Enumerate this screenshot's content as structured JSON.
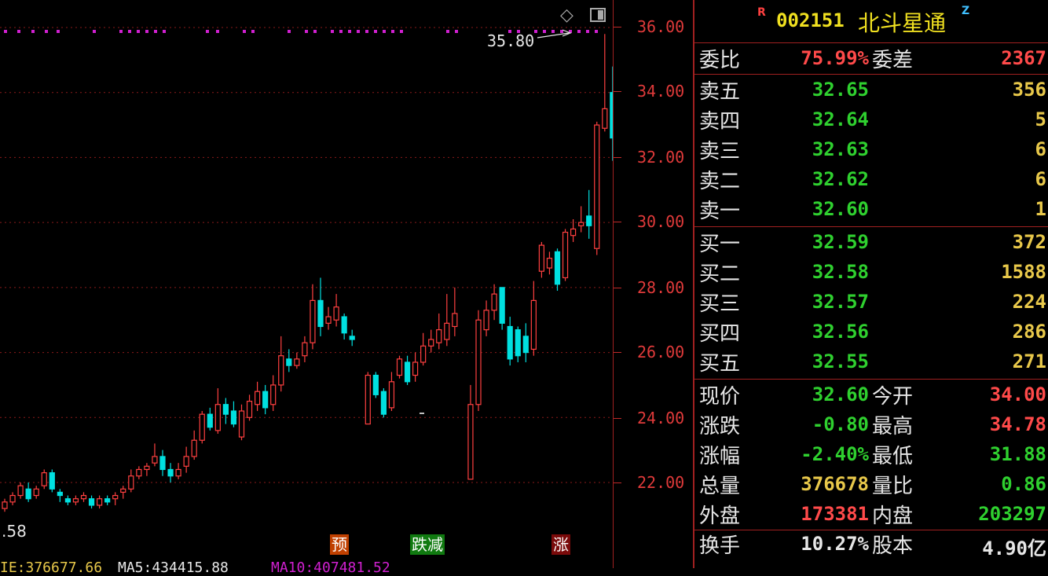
{
  "stock": {
    "r_mark": "R",
    "code": "002151",
    "name": "北斗星通",
    "z_mark": "Z"
  },
  "commission": {
    "ratio_label": "委比",
    "ratio_value": "75.99%",
    "diff_label": "委差",
    "diff_value": "2367"
  },
  "sell": [
    {
      "label": "卖五",
      "price": "32.65",
      "vol": "356"
    },
    {
      "label": "卖四",
      "price": "32.64",
      "vol": "5"
    },
    {
      "label": "卖三",
      "price": "32.63",
      "vol": "6"
    },
    {
      "label": "卖二",
      "price": "32.62",
      "vol": "6"
    },
    {
      "label": "卖一",
      "price": "32.60",
      "vol": "1"
    }
  ],
  "buy": [
    {
      "label": "买一",
      "price": "32.59",
      "vol": "372"
    },
    {
      "label": "买二",
      "price": "32.58",
      "vol": "1588"
    },
    {
      "label": "买三",
      "price": "32.57",
      "vol": "224"
    },
    {
      "label": "买四",
      "price": "32.56",
      "vol": "286"
    },
    {
      "label": "买五",
      "price": "32.55",
      "vol": "271"
    }
  ],
  "quote": [
    {
      "l1": "现价",
      "v1": "32.60",
      "c1": "#2fd02f",
      "l2": "今开",
      "v2": "34.00",
      "c2": "#ff4a4a"
    },
    {
      "l1": "涨跌",
      "v1": "-0.80",
      "c1": "#2fd02f",
      "l2": "最高",
      "v2": "34.78",
      "c2": "#ff4a4a"
    },
    {
      "l1": "涨幅",
      "v1": "-2.40%",
      "c1": "#2fd02f",
      "l2": "最低",
      "v2": "31.88",
      "c2": "#2fd02f"
    },
    {
      "l1": "总量",
      "v1": "376678",
      "c1": "#e8c84a",
      "l2": "量比",
      "v2": "0.86",
      "c2": "#2fd02f"
    },
    {
      "l1": "外盘",
      "v1": "173381",
      "c1": "#ff4a4a",
      "l2": "内盘",
      "v2": "203297",
      "c2": "#2fd02f"
    },
    {
      "l1": "换手",
      "v1": "10.27%",
      "c1": "#e6e6e6",
      "l2": "股本",
      "v2": "4.90亿",
      "c2": "#e6e6e6"
    }
  ],
  "colors": {
    "up": "#ff4040",
    "down": "#00e0e0",
    "grid": "#8a1a1a",
    "dots": "#d020d0",
    "axis_text": "#e03a3a",
    "green": "#2fd02f",
    "yellow": "#e8c84a",
    "red": "#ff4a4a"
  },
  "icons": {
    "diamond": "diamond-icon",
    "panel": "panel-toggle-icon"
  },
  "chart_data": {
    "type": "candlestick",
    "y_ticks": [
      "36.00",
      "34.00",
      "32.00",
      "30.00",
      "28.00",
      "26.00",
      "24.00",
      "22.00"
    ],
    "ylim": [
      21.0,
      36.8
    ],
    "high_annotation": "35.80",
    "left_price_label": ".58",
    "candles": [
      [
        21.2,
        21.4,
        21.1,
        21.5
      ],
      [
        21.4,
        21.6,
        21.3,
        21.7
      ],
      [
        21.6,
        21.9,
        21.5,
        22.0
      ],
      [
        21.8,
        21.5,
        21.4,
        22.0
      ],
      [
        21.6,
        21.8,
        21.5,
        21.9
      ],
      [
        21.9,
        22.3,
        21.8,
        22.4
      ],
      [
        22.3,
        21.8,
        21.7,
        22.4
      ],
      [
        21.7,
        21.6,
        21.4,
        21.8
      ],
      [
        21.5,
        21.4,
        21.3,
        21.6
      ],
      [
        21.4,
        21.5,
        21.3,
        21.6
      ],
      [
        21.5,
        21.6,
        21.4,
        21.7
      ],
      [
        21.5,
        21.3,
        21.2,
        21.6
      ],
      [
        21.3,
        21.5,
        21.2,
        21.6
      ],
      [
        21.5,
        21.4,
        21.3,
        21.6
      ],
      [
        21.5,
        21.6,
        21.3,
        21.7
      ],
      [
        21.7,
        21.8,
        21.5,
        21.9
      ],
      [
        21.8,
        22.2,
        21.7,
        22.4
      ],
      [
        22.2,
        22.4,
        22.1,
        22.5
      ],
      [
        22.4,
        22.5,
        22.2,
        22.6
      ],
      [
        22.6,
        22.8,
        22.5,
        23.2
      ],
      [
        22.8,
        22.4,
        22.2,
        23.0
      ],
      [
        22.4,
        22.2,
        22.0,
        22.6
      ],
      [
        22.2,
        22.4,
        22.1,
        22.6
      ],
      [
        22.5,
        22.8,
        22.3,
        23.1
      ],
      [
        22.8,
        23.3,
        22.7,
        23.6
      ],
      [
        23.3,
        24.1,
        23.2,
        24.2
      ],
      [
        24.1,
        23.7,
        23.6,
        24.3
      ],
      [
        23.6,
        24.4,
        23.5,
        24.9
      ],
      [
        24.4,
        24.1,
        23.8,
        24.6
      ],
      [
        24.2,
        23.8,
        23.7,
        24.5
      ],
      [
        23.4,
        24.2,
        23.3,
        24.4
      ],
      [
        24.0,
        24.5,
        23.9,
        24.7
      ],
      [
        24.4,
        24.8,
        24.2,
        25.1
      ],
      [
        24.8,
        24.3,
        24.1,
        25.0
      ],
      [
        24.4,
        25.0,
        24.2,
        25.3
      ],
      [
        25.0,
        25.9,
        24.8,
        26.5
      ],
      [
        25.8,
        25.6,
        25.4,
        26.1
      ],
      [
        25.6,
        25.8,
        25.5,
        26.0
      ],
      [
        25.9,
        26.3,
        25.7,
        26.5
      ],
      [
        26.3,
        27.6,
        26.1,
        28.1
      ],
      [
        27.6,
        26.8,
        26.5,
        28.3
      ],
      [
        26.9,
        27.1,
        26.7,
        27.4
      ],
      [
        27.0,
        27.4,
        26.8,
        27.8
      ],
      [
        27.1,
        26.6,
        26.4,
        27.2
      ],
      [
        26.5,
        26.4,
        26.2,
        26.7
      ],
      [
        0,
        0,
        0,
        0
      ],
      [
        23.8,
        25.3,
        23.8,
        25.4
      ],
      [
        25.3,
        24.7,
        24.6,
        25.4
      ],
      [
        24.8,
        24.1,
        24.0,
        24.9
      ],
      [
        24.3,
        25.1,
        24.2,
        25.4
      ],
      [
        25.3,
        25.8,
        25.2,
        25.9
      ],
      [
        25.7,
        25.1,
        25.0,
        25.9
      ],
      [
        25.3,
        25.7,
        25.1,
        26.0
      ],
      [
        25.7,
        26.2,
        25.6,
        26.6
      ],
      [
        26.2,
        26.4,
        26.0,
        26.7
      ],
      [
        26.3,
        26.7,
        26.1,
        27.2
      ],
      [
        26.4,
        26.9,
        26.2,
        27.8
      ],
      [
        26.8,
        27.2,
        26.5,
        28.0
      ],
      [
        0,
        0,
        0,
        0
      ],
      [
        22.1,
        24.4,
        22.1,
        25.0
      ],
      [
        24.4,
        27.0,
        24.2,
        27.3
      ],
      [
        26.7,
        27.3,
        26.5,
        27.6
      ],
      [
        27.3,
        27.8,
        27.0,
        28.1
      ],
      [
        28.0,
        26.9,
        26.7,
        28.0
      ],
      [
        26.8,
        25.8,
        25.6,
        27.1
      ],
      [
        26.7,
        25.9,
        25.7,
        26.8
      ],
      [
        26.5,
        26.0,
        25.7,
        26.9
      ],
      [
        26.1,
        27.6,
        25.9,
        28.2
      ],
      [
        28.5,
        29.3,
        28.3,
        29.4
      ],
      [
        28.6,
        28.9,
        28.4,
        29.1
      ],
      [
        29.1,
        28.1,
        27.9,
        29.2
      ],
      [
        28.3,
        29.7,
        28.2,
        29.8
      ],
      [
        29.6,
        29.8,
        29.4,
        30.1
      ],
      [
        29.9,
        30.0,
        29.7,
        30.5
      ],
      [
        30.2,
        29.9,
        29.5,
        31.0
      ],
      [
        29.2,
        33.0,
        29.0,
        33.1
      ],
      [
        32.9,
        33.5,
        32.8,
        35.8
      ],
      [
        34.0,
        32.6,
        31.9,
        34.8
      ]
    ]
  },
  "markers": [
    {
      "text": "预",
      "color": "#c04000"
    },
    {
      "text": "跌减",
      "color": "#107a10"
    },
    {
      "text": "涨",
      "color": "#7a0a0a"
    }
  ],
  "ma_line": [
    {
      "text": "IE:376677.66",
      "color": "#e8c84a"
    },
    {
      "text": "MA5:434415.88",
      "color": "#e8e8e8"
    },
    {
      "text": "MA10:407481.52",
      "color": "#d020d0"
    }
  ]
}
